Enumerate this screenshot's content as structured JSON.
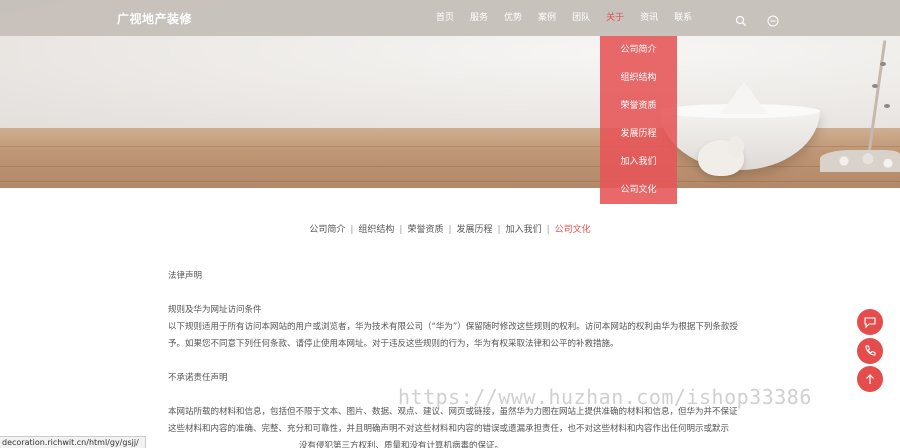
{
  "header": {
    "logo": "广视地产装修"
  },
  "nav": {
    "items": [
      "首页",
      "服务",
      "优势",
      "案例",
      "团队",
      "关于",
      "资讯",
      "联系"
    ],
    "active_index": 5
  },
  "dropdown": {
    "items": [
      "公司简介",
      "组织结构",
      "荣誉资质",
      "发展历程",
      "加入我们",
      "公司文化"
    ]
  },
  "subnav": {
    "items": [
      "公司简介",
      "组织结构",
      "荣誉资质",
      "发展历程",
      "加入我们",
      "公司文化"
    ],
    "active_index": 5
  },
  "content": {
    "heading": "法律声明",
    "section1_title": "规则及华为网址访问条件",
    "section1_line1": "以下规则适用于所有访问本网站的用户或浏览者，华为技术有限公司（“华为”）保留随时修改这些规则的权利。访问本网站的权利由华为根据下列条款授",
    "section1_line2": "予。如果您不同意下列任何条款、请停止使用本网址。对于违反这些规则的行为，华为有权采取法律和公平的补救措施。",
    "section2_title": "不承诺责任声明",
    "section2_line1": "本网站所载的材料和信息，包括但不限于文本、图片、数据、观点、建议、网页或链接，虽然华为力图在网站上提供准确的材料和信息，但华为并不保证",
    "section2_line2": "这些材料和内容的准确、完整、充分和可靠性，并且明确声明不对这些材料和内容的错误或遗漏承担责任，也不对这些材料和内容作出任何明示或默示",
    "section2_line3": "没有侵犯第三方权利、质量和没有计算机病毒的保证。"
  },
  "watermark": "https://www.huzhan.com/ishop33386",
  "status_url": "decoration.richwit.cn/html/gy/gsjj/",
  "colors": {
    "accent": "#e54d4d",
    "dropdown_bg": "#e65456"
  },
  "icons": [
    "search-icon",
    "user-icon",
    "chat-icon",
    "phone-icon",
    "arrow-up-icon"
  ]
}
